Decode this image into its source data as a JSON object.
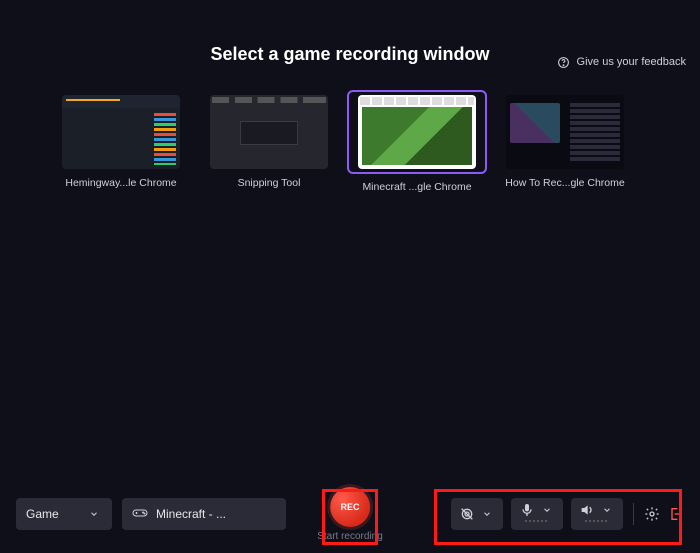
{
  "feedback": {
    "label": "Give us your feedback"
  },
  "title": "Select a game recording window",
  "windows": [
    {
      "label": "Hemingway...le Chrome"
    },
    {
      "label": "Snipping Tool"
    },
    {
      "label": "Minecraft ...gle Chrome",
      "selected": true
    },
    {
      "label": "How To Rec...gle Chrome"
    }
  ],
  "bottombar": {
    "mode": "Game",
    "window_label": "Minecraft - ...",
    "rec_text": "REC",
    "rec_label": "Start recording"
  }
}
